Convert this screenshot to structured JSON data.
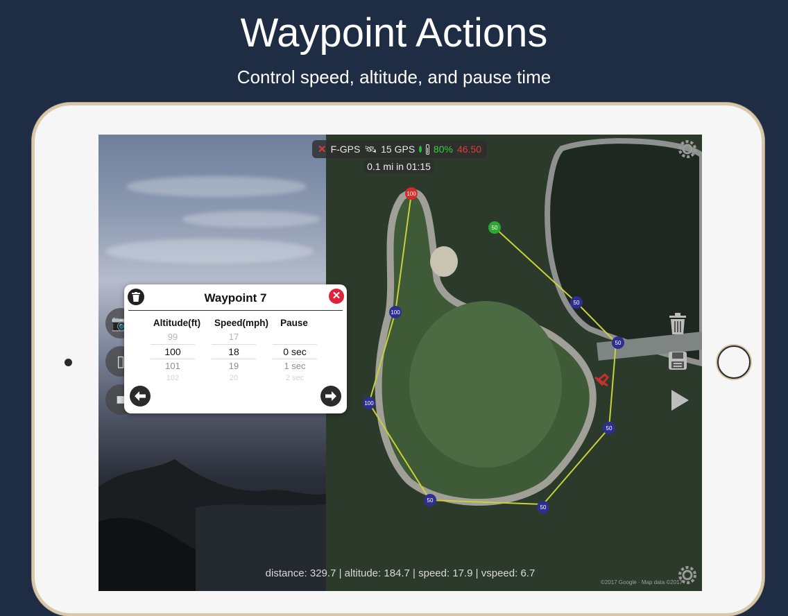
{
  "headline": "Waypoint Actions",
  "subline": "Control speed, altitude, and pause time",
  "status": {
    "fgps": "F-GPS",
    "gps": "15 GPS",
    "battery": "80%",
    "voltage": "46.50"
  },
  "eta": "0.1 mi in 01:15",
  "dialog": {
    "title": "Waypoint 7",
    "columns": {
      "altitude": "Altitude(ft)",
      "speed": "Speed(mph)",
      "pause": "Pause"
    },
    "altitude": [
      "99",
      "100",
      "101",
      "102"
    ],
    "speed": [
      "17",
      "18",
      "19",
      "20"
    ],
    "pause": [
      "",
      "0 sec",
      "1 sec",
      "2 sec"
    ]
  },
  "waypoints": [
    "100",
    "100",
    "100",
    "50",
    "50",
    "50",
    "50",
    "50",
    "50"
  ],
  "readout": "distance: 329.7 | altitude: 184.7 | speed: 17.9 | vspeed: 6.7",
  "copyright": "©2017 Google · Map data ©2017",
  "colors": {
    "background": "#1f2d44",
    "route": "#c7d23a",
    "waypoint": "#2d2f8f",
    "start_waypoint": "#2ea831",
    "end_waypoint": "#d32b2b",
    "close": "#e0213a"
  }
}
